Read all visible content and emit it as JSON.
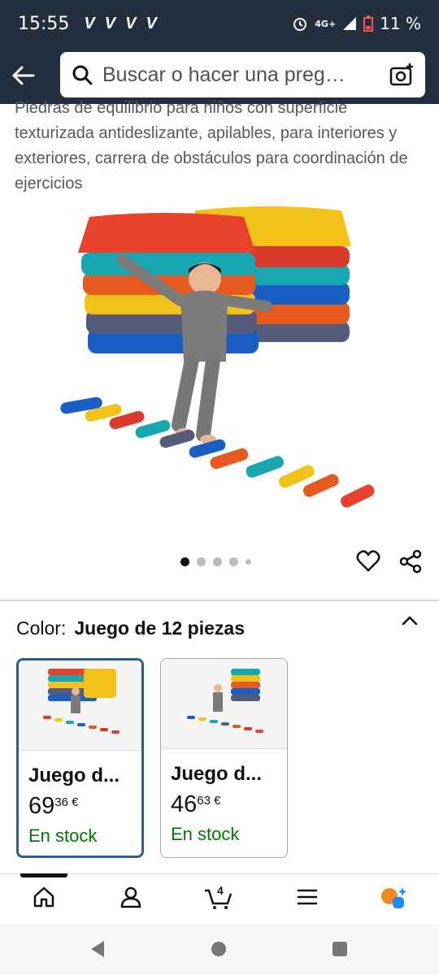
{
  "status_bar": {
    "time": "15:55",
    "notifications": [
      "V",
      "V",
      "V",
      "V"
    ],
    "network": "4G+",
    "battery": "11 %"
  },
  "search": {
    "placeholder": "Buscar o hacer una preg…"
  },
  "product": {
    "description": "Piedras de equilibrio para niños con superficie texturizada antideslizante, apilables, para interiores y exteriores, carrera de obstáculos para coordinación de ejercicios",
    "image_count": 5,
    "active_image": 1
  },
  "color_selector": {
    "label": "Color:",
    "value": "Juego de 12 piezas"
  },
  "variants": [
    {
      "name": "Juego d...",
      "price_whole": "69",
      "price_fraction": "36 €",
      "stock": "En stock",
      "selected": true
    },
    {
      "name": "Juego d...",
      "price_whole": "46",
      "price_fraction": "63 €",
      "stock": "En stock",
      "selected": false
    }
  ],
  "bottom_nav": {
    "cart_count": "4"
  },
  "colors": {
    "header_bg": "#232f3e",
    "in_stock": "#007600",
    "selected_border": "#2d5d8b"
  }
}
